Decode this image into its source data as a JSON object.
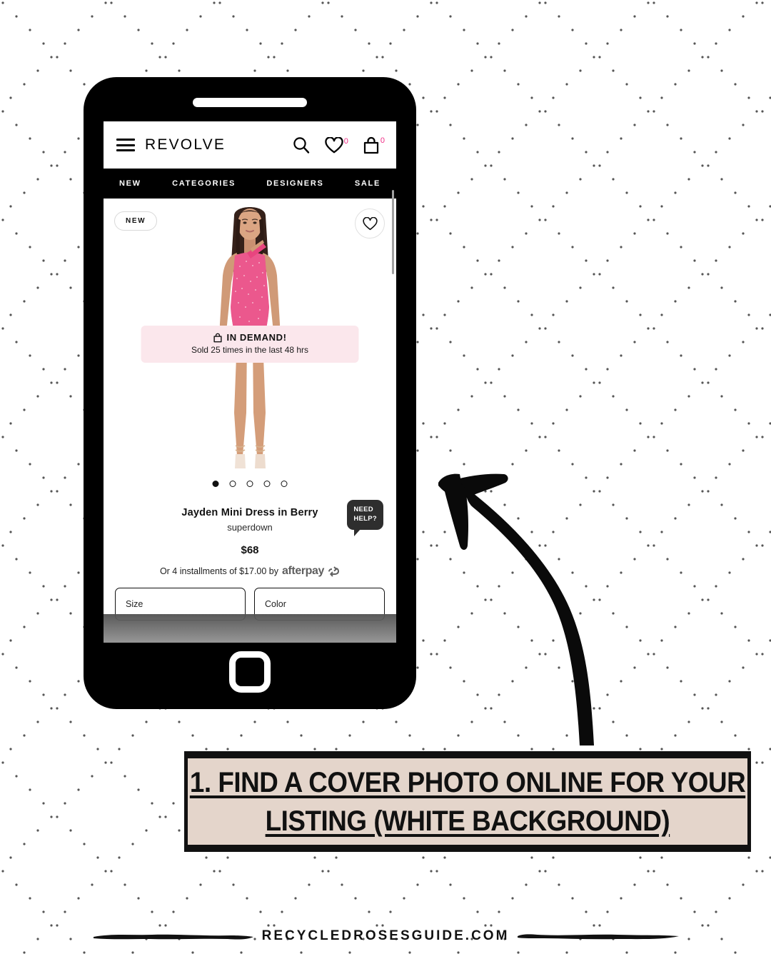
{
  "background": {
    "pattern": "diagonal-dotted-quilt",
    "dot_color": "#555555",
    "page_bg": "#ffffff"
  },
  "phone": {
    "frame_color": "#000000",
    "speaker_name": "speaker-bar",
    "home_button_name": "home-button"
  },
  "app": {
    "brand": "REVOLVE",
    "header_icons": {
      "menu": "hamburger-menu-icon",
      "search": "search-icon",
      "wishlist": "heart-icon",
      "wishlist_count": "0",
      "bag": "shopping-bag-icon",
      "bag_count": "0",
      "count_color": "#ef2c85"
    },
    "nav": [
      "NEW",
      "CATEGORIES",
      "DESIGNERS",
      "SALE"
    ],
    "product_image": {
      "badge": "NEW",
      "wishlist_icon": "heart-outline-icon",
      "dress_color": "#e8457f",
      "carousel": {
        "total": 5,
        "active_index": 0
      }
    },
    "in_demand": {
      "icon": "shopping-bag-icon",
      "title": "IN DEMAND!",
      "subtitle": "Sold 25 times in the last 48 hrs",
      "bg": "#fbe7ec"
    },
    "product": {
      "title": "Jayden Mini Dress in Berry",
      "brand": "superdown",
      "price": "$68",
      "installments_text": "Or 4 installments of $17.00 by",
      "installments_brand": "afterpay"
    },
    "need_help": {
      "line1": "NEED",
      "line2": "HELP?"
    },
    "selectors": [
      {
        "name": "size-select",
        "label": "Size"
      },
      {
        "name": "color-select",
        "label": "Color"
      }
    ]
  },
  "annotation": {
    "arrow": "curved-arrow-up-left",
    "caption_line_1": "1. FIND A COVER PHOTO ONLINE FOR YOUR",
    "caption_line_2": "LISTING (WHITE BACKGROUND)",
    "caption_bg": "#e4d5cb"
  },
  "footer": {
    "url": "RECYCLEDROSESGUIDE.COM"
  }
}
